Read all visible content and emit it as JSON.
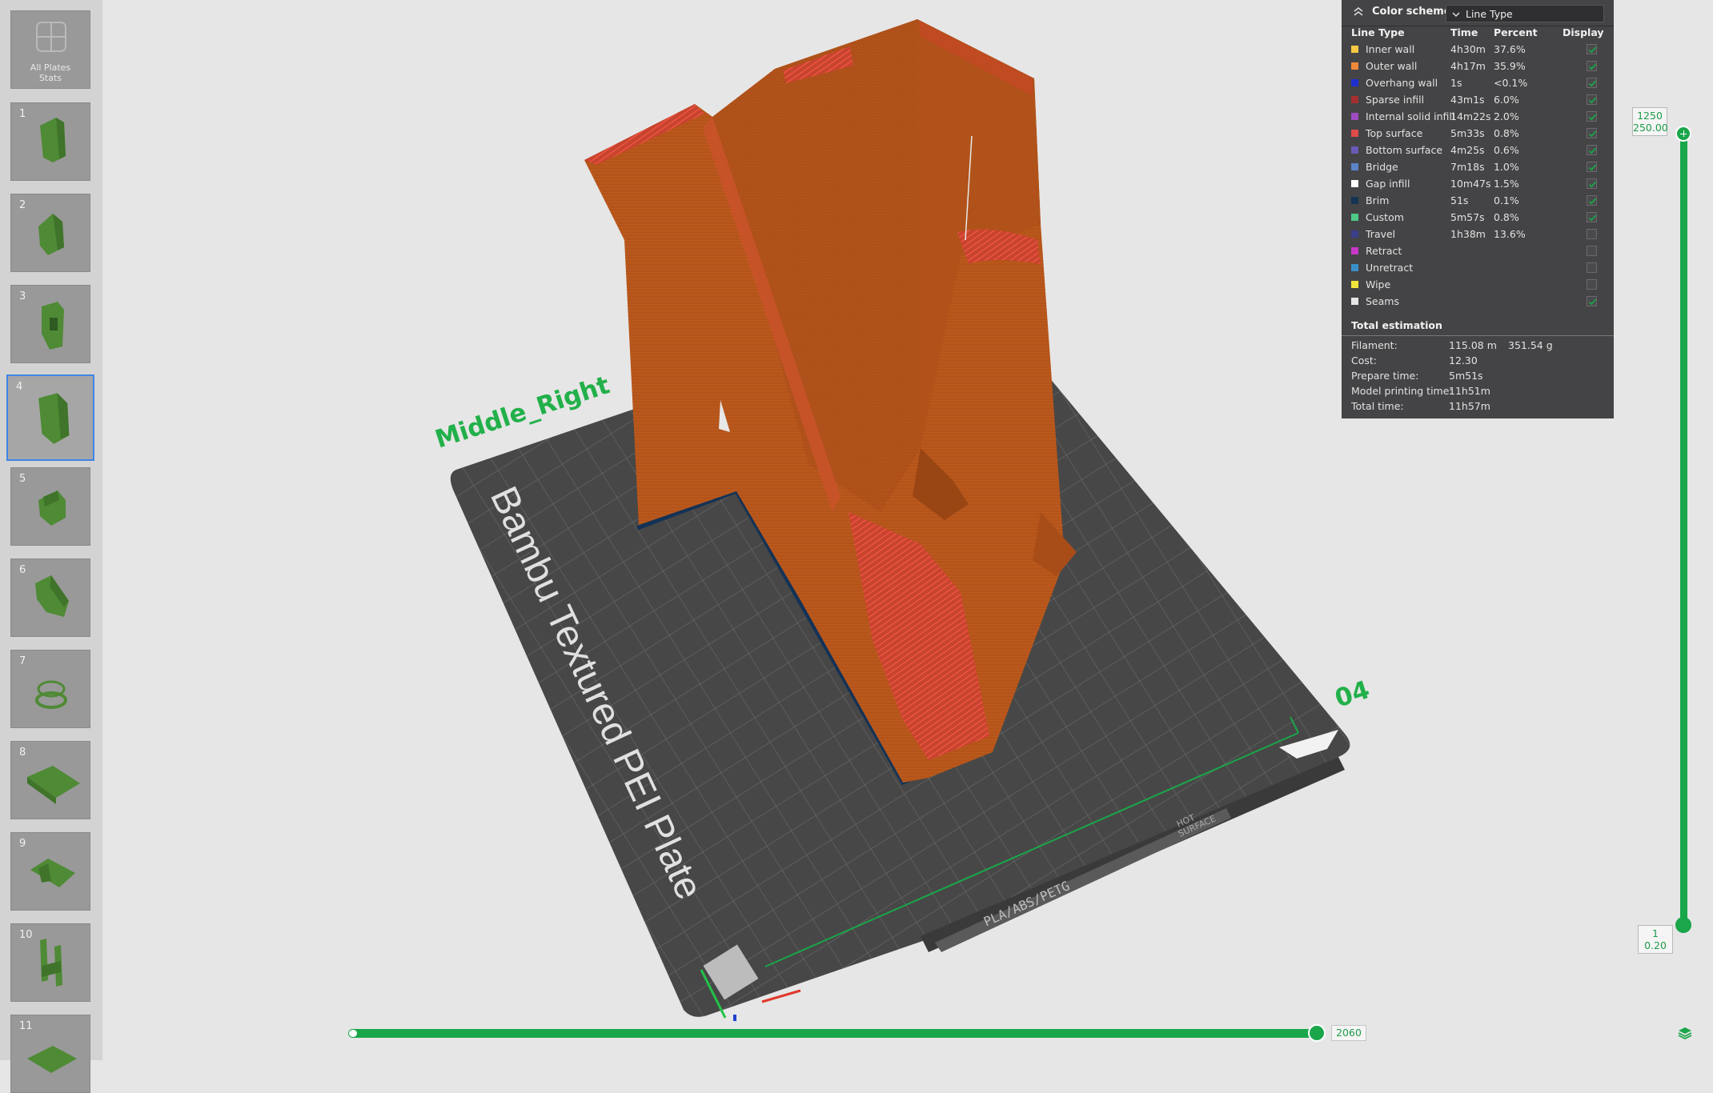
{
  "plates": {
    "all_label_line1": "All Plates",
    "all_label_line2": "Stats",
    "numbers": [
      "1",
      "2",
      "3",
      "4",
      "5",
      "6",
      "7",
      "8",
      "9",
      "10",
      "11"
    ],
    "selected": "4"
  },
  "scene": {
    "object_name": "Middle_Right",
    "plate_number": "04",
    "plate_name": "Bambu Textured PEI Plate",
    "plate_material_label": "PLA/ABS/PETG",
    "plate_hot_label_line1": "HOT",
    "plate_hot_label_line2": "SURFACE"
  },
  "legend": {
    "title": "Color scheme",
    "scheme": "Line Type",
    "columns": {
      "type": "Line Type",
      "time": "Time",
      "percent": "Percent",
      "display": "Display"
    },
    "rows": [
      {
        "name": "Inner wall",
        "time": "4h30m",
        "percent": "37.6%",
        "color": "#f7c843",
        "checked": true
      },
      {
        "name": "Outer wall",
        "time": "4h17m",
        "percent": "35.9%",
        "color": "#f08a3a",
        "checked": true
      },
      {
        "name": "Overhang wall",
        "time": "1s",
        "percent": "<0.1%",
        "color": "#1f2fcf",
        "checked": true
      },
      {
        "name": "Sparse infill",
        "time": "43m1s",
        "percent": "6.0%",
        "color": "#a52f2f",
        "checked": true
      },
      {
        "name": "Internal solid infill",
        "time": "14m22s",
        "percent": "2.0%",
        "color": "#a04ac2",
        "checked": true
      },
      {
        "name": "Top surface",
        "time": "5m33s",
        "percent": "0.8%",
        "color": "#e04a4a",
        "checked": true
      },
      {
        "name": "Bottom surface",
        "time": "4m25s",
        "percent": "0.6%",
        "color": "#6a5ab8",
        "checked": true
      },
      {
        "name": "Bridge",
        "time": "7m18s",
        "percent": "1.0%",
        "color": "#5a84c8",
        "checked": true
      },
      {
        "name": "Gap infill",
        "time": "10m47s",
        "percent": "1.5%",
        "color": "#ffffff",
        "checked": true
      },
      {
        "name": "Brim",
        "time": "51s",
        "percent": "0.1%",
        "color": "#153352",
        "checked": true
      },
      {
        "name": "Custom",
        "time": "5m57s",
        "percent": "0.8%",
        "color": "#4ec988",
        "checked": true
      },
      {
        "name": "Travel",
        "time": "1h38m",
        "percent": "13.6%",
        "color": "#3a3f8a",
        "checked": false
      },
      {
        "name": "Retract",
        "time": "",
        "percent": "",
        "color": "#c837c8",
        "checked": false
      },
      {
        "name": "Unretract",
        "time": "",
        "percent": "",
        "color": "#3a8fc8",
        "checked": false
      },
      {
        "name": "Wipe",
        "time": "",
        "percent": "",
        "color": "#f2e43a",
        "checked": false
      },
      {
        "name": "Seams",
        "time": "",
        "percent": "",
        "color": "#e6e6e6",
        "checked": true
      }
    ],
    "total_title": "Total estimation",
    "stats": [
      {
        "label": "Filament:",
        "value": "115.08 m",
        "extra": "351.54 g"
      },
      {
        "label": "Cost:",
        "value": "12.30",
        "extra": ""
      },
      {
        "label": "Prepare time:",
        "value": "5m51s",
        "extra": ""
      },
      {
        "label": "Model printing time:",
        "value": "11h51m",
        "extra": ""
      },
      {
        "label": "Total time:",
        "value": "11h57m",
        "extra": ""
      }
    ]
  },
  "layer_slider": {
    "top_layer": "1250",
    "top_height": "250.00",
    "bottom_layer": "1",
    "bottom_height": "0.20"
  },
  "move_slider": {
    "value": "2060"
  },
  "colors": {
    "accent_green": "#1aa64a",
    "model_orange": "#b5541a",
    "bed_dark": "#454545"
  }
}
